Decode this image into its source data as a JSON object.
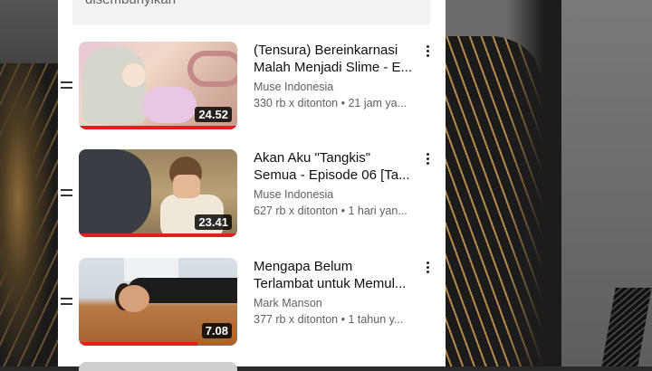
{
  "banner": {
    "text": "disembunyikan"
  },
  "playlist": [
    {
      "title_line1": "(Tensura) Bereinkarnasi",
      "title_line2": "Malah Menjadi Slime - E...",
      "channel": "Muse Indonesia",
      "meta": "330 rb x ditonton • 21 jam ya...",
      "duration": "24.52",
      "watched_fraction": 1.0
    },
    {
      "title_line1": "Akan Aku \"Tangkis\"",
      "title_line2": "Semua - Episode 06 [Ta...",
      "channel": "Muse Indonesia",
      "meta": "627 rb x ditonton • 1 hari yan...",
      "duration": "23.41",
      "watched_fraction": 1.0
    },
    {
      "title_line1": "Mengapa Belum",
      "title_line2": "Terlambat untuk Memul...",
      "channel": "Mark Manson",
      "meta": "377 rb x ditonton • 1 tahun y...",
      "duration": "7.08",
      "watched_fraction": 0.75
    }
  ],
  "icons": {
    "drag": "drag-handle-icon",
    "more": "more-vert-icon"
  },
  "colors": {
    "progress": "#e31e1e",
    "panel": "#ffffff",
    "text_secondary": "#606060"
  }
}
